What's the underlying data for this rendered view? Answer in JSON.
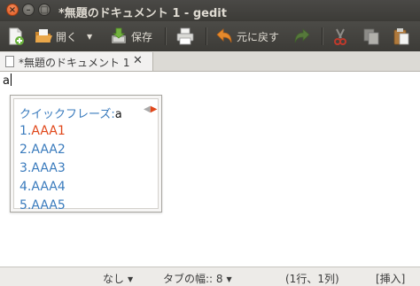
{
  "window": {
    "title": "*無題のドキュメント 1 - gedit",
    "close_glyph": "×",
    "min_glyph": "–",
    "max_glyph": "□"
  },
  "toolbar": {
    "open_label": "開く",
    "save_label": "保存",
    "undo_label": "元に戻す",
    "icons": [
      "new-document-icon",
      "open-folder-icon",
      "save-icon",
      "print-icon",
      "undo-icon",
      "redo-icon",
      "cut-icon",
      "copy-icon",
      "paste-icon"
    ]
  },
  "tab": {
    "label": "*無題のドキュメント 1",
    "close_glyph": "✕"
  },
  "editor": {
    "text": "a"
  },
  "completion": {
    "header_label": "クイックフレーズ:",
    "typed": "a",
    "items": [
      "AAA1",
      "AAA2",
      "AAA3",
      "AAA4",
      "AAA5"
    ],
    "numbers": [
      "1.",
      "2.",
      "3.",
      "4.",
      "5."
    ],
    "selected_index": 0,
    "colors": {
      "label": "#3a7bbd",
      "selected": "#e0471a"
    }
  },
  "statusbar": {
    "language": "なし",
    "tab_width_label": "タブの幅:: 8",
    "position": "(1行、1列)",
    "mode": "[挿入]"
  }
}
